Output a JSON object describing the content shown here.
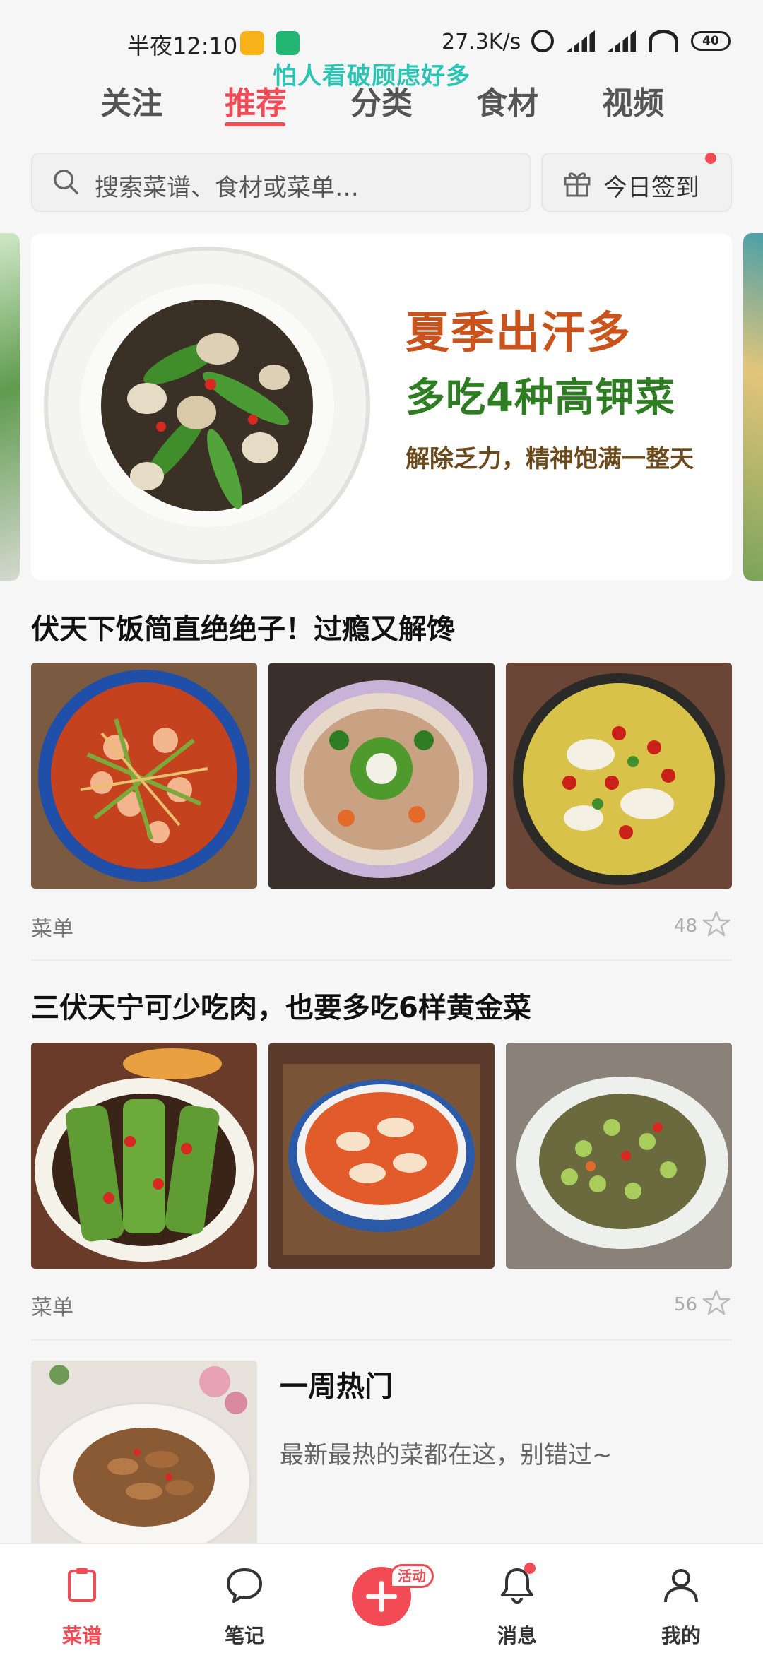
{
  "status_bar": {
    "time": "半夜12:10",
    "network_speed": "27.3K/s",
    "battery": "40",
    "marquee": "怕人看破顾虑好多"
  },
  "top_tabs": [
    "关注",
    "推荐",
    "分类",
    "食材",
    "视频"
  ],
  "active_tab": "推荐",
  "search": {
    "placeholder": "搜索菜谱、食材或菜单…",
    "checkin_label": "今日签到"
  },
  "banner": {
    "title": "夏季出汗多",
    "subtitle": "多吃4种高钾菜",
    "caption": "解除乏力，精神饱满一整天"
  },
  "menus": [
    {
      "title": "伏天下饭简直绝绝子！过瘾又解馋",
      "label": "菜单",
      "count": "48"
    },
    {
      "title": "三伏天宁可少吃肉，也要多吃6样黄金菜",
      "label": "菜单",
      "count": "56"
    }
  ],
  "weekly": {
    "title": "一周热门",
    "desc": "最新最热的菜都在这，别错过~"
  },
  "bottom_nav": {
    "recipes": "菜谱",
    "notes": "笔记",
    "activity_tag": "活动",
    "messages": "消息",
    "mine": "我的"
  },
  "colors": {
    "accent": "#f24b56",
    "marquee": "#2bc4b3",
    "banner_title": "#c9531a",
    "banner_subtitle": "#2f7d23"
  }
}
